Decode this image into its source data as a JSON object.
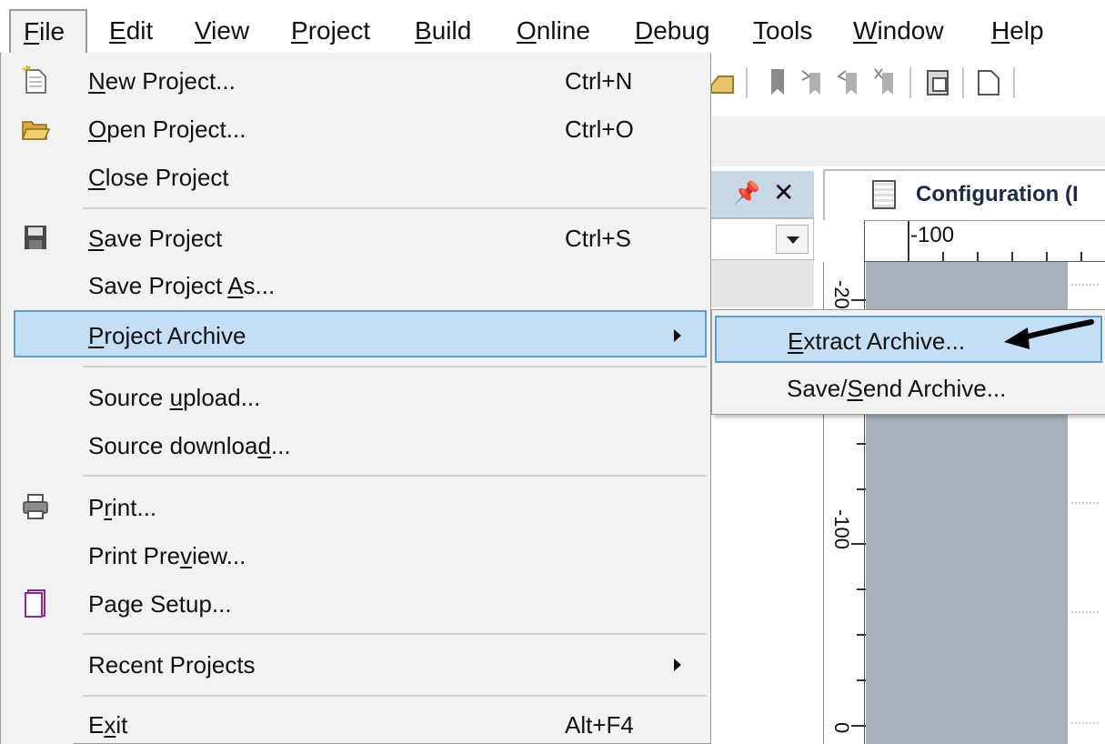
{
  "menubar": {
    "items": [
      {
        "pre": "",
        "u": "F",
        "post": "ile"
      },
      {
        "pre": "",
        "u": "E",
        "post": "dit"
      },
      {
        "pre": "",
        "u": "V",
        "post": "iew"
      },
      {
        "pre": "",
        "u": "P",
        "post": "roject"
      },
      {
        "pre": "",
        "u": "B",
        "post": "uild"
      },
      {
        "pre": "",
        "u": "O",
        "post": "nline"
      },
      {
        "pre": "",
        "u": "D",
        "post": "ebug"
      },
      {
        "pre": "",
        "u": "T",
        "post": "ools"
      },
      {
        "pre": "",
        "u": "W",
        "post": "indow"
      },
      {
        "pre": "",
        "u": "H",
        "post": "elp"
      }
    ]
  },
  "file_menu": {
    "items": [
      {
        "pre": "",
        "u": "N",
        "post": "ew Project...",
        "shortcut": "Ctrl+N"
      },
      {
        "pre": "",
        "u": "O",
        "post": "pen Project...",
        "shortcut": "Ctrl+O"
      },
      {
        "pre": "",
        "u": "C",
        "post": "lose Project",
        "shortcut": ""
      },
      {
        "pre": "",
        "u": "S",
        "post": "ave Project",
        "shortcut": "Ctrl+S"
      },
      {
        "pre": "Save Project ",
        "u": "A",
        "post": "s...",
        "shortcut": ""
      },
      {
        "pre": "",
        "u": "P",
        "post": "roject Archive",
        "shortcut": ""
      },
      {
        "pre": "Source ",
        "u": "u",
        "post": "pload...",
        "shortcut": ""
      },
      {
        "pre": "Source downloa",
        "u": "d",
        "post": "...",
        "shortcut": ""
      },
      {
        "pre": "P",
        "u": "r",
        "post": "int...",
        "shortcut": ""
      },
      {
        "pre": "Print Pre",
        "u": "v",
        "post": "iew...",
        "shortcut": ""
      },
      {
        "pre": "Pa",
        "u": "g",
        "post": "e Setup...",
        "shortcut": ""
      },
      {
        "pre": "Recent Pro",
        "u": "j",
        "post": "ects",
        "shortcut": ""
      },
      {
        "pre": "E",
        "u": "x",
        "post": "it",
        "shortcut": "Alt+F4"
      }
    ]
  },
  "submenu": {
    "items": [
      {
        "pre": "",
        "u": "E",
        "post": "xtract Archive..."
      },
      {
        "pre": "Save/",
        "u": "S",
        "post": "end Archive..."
      }
    ]
  },
  "document": {
    "tab_label": "Configuration (I",
    "h_ruler_label": "-100",
    "v_ruler_labels": [
      "-20",
      "-100",
      "0"
    ]
  },
  "colors": {
    "highlight": "#c4def5",
    "highlight_border": "#5d9dd6",
    "menu_bg": "#f2f2f2",
    "canvas": "#a7b0b8"
  }
}
